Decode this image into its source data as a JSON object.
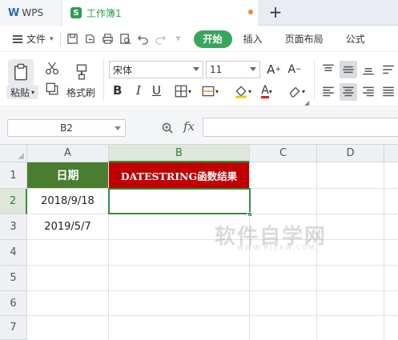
{
  "titlebar": {
    "app_name": "WPS",
    "doc_tab_title": "工作簿1",
    "doc_icon_letter": "S",
    "add_tab_symbol": "+"
  },
  "menubar": {
    "file_label": "文件",
    "start_label": "开始",
    "items": [
      "插入",
      "页面布局",
      "公式"
    ]
  },
  "ribbon": {
    "paste_label": "粘贴",
    "format_painter_label": "格式刷",
    "font_name": "宋体",
    "font_size": "11",
    "bold": "B",
    "italic": "I",
    "underline": "U"
  },
  "formula_bar": {
    "cell_ref": "B2",
    "fx_label": "fx",
    "formula_value": ""
  },
  "sheet": {
    "columns": [
      "A",
      "B",
      "C",
      "D"
    ],
    "rows": [
      "1",
      "2",
      "3",
      "4",
      "5",
      "6",
      "7"
    ],
    "active_cell": "B2",
    "cells": {
      "A1": "日期",
      "B1": "DATESTRING函数结果",
      "A2": "2018/9/18",
      "A3": "2019/5/7"
    },
    "header_colors": {
      "A1": "#4a7d2f",
      "B1": "#c00000"
    },
    "watermark": "软件自学网",
    "watermark_sub": "WWW.RJZXW.COM"
  }
}
